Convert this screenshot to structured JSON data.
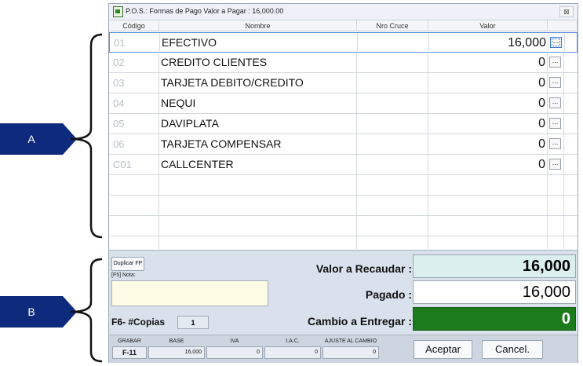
{
  "window": {
    "title": "P.O.S.: Formas de Pago   Valor a Pagar : 16,000.00",
    "close_label": "⊠"
  },
  "grid": {
    "headers": [
      "Código",
      "Nombre",
      "Nro Cruce",
      "Valor"
    ],
    "rows": [
      {
        "code": "01",
        "name": "EFECTIVO",
        "cruce": "",
        "value": "16,000"
      },
      {
        "code": "02",
        "name": "CREDITO CLIENTES",
        "cruce": "",
        "value": "0"
      },
      {
        "code": "03",
        "name": "TARJETA DEBITO/CREDITO",
        "cruce": "",
        "value": "0"
      },
      {
        "code": "04",
        "name": "NEQUI",
        "cruce": "",
        "value": "0"
      },
      {
        "code": "05",
        "name": "DAVIPLATA",
        "cruce": "",
        "value": "0"
      },
      {
        "code": "06",
        "name": "TARJETA COMPENSAR",
        "cruce": "",
        "value": "0"
      },
      {
        "code": "C01",
        "name": "CALLCENTER",
        "cruce": "",
        "value": "0"
      }
    ],
    "row_button_label": "..."
  },
  "panel": {
    "duplicar_label": "Duplicar FP",
    "nota_label": "[F5] Nota:",
    "nota_value": "",
    "copias_label": "F6- #Copias",
    "copias_value": "1",
    "recaudar_label": "Valor a Recaudar :",
    "recaudar_value": "16,000",
    "pagado_label": "Pagado  :",
    "pagado_value": "16,000",
    "cambio_label": "Cambio a Entregar :",
    "cambio_value": "0"
  },
  "footer": {
    "grabar_label": "GRABAR",
    "grabar_key": "F-11",
    "base_label": "BASE",
    "base_value": "16,000",
    "iva_label": "IVA",
    "iva_value": "0",
    "iac_label": "I.A.C.",
    "iac_value": "0",
    "ajuste_label": "AJUSTE AL CAMBIO",
    "ajuste_value": "0",
    "aceptar_label": "Aceptar",
    "cancel_label": "Cancel."
  },
  "annotations": {
    "a_label": "A",
    "b_label": "B"
  },
  "colors": {
    "marker": "#0d2a7d",
    "cambio_bg": "#1c7c1c",
    "recaudar_bg": "#dcefef",
    "nota_bg": "#fdfbe4"
  }
}
